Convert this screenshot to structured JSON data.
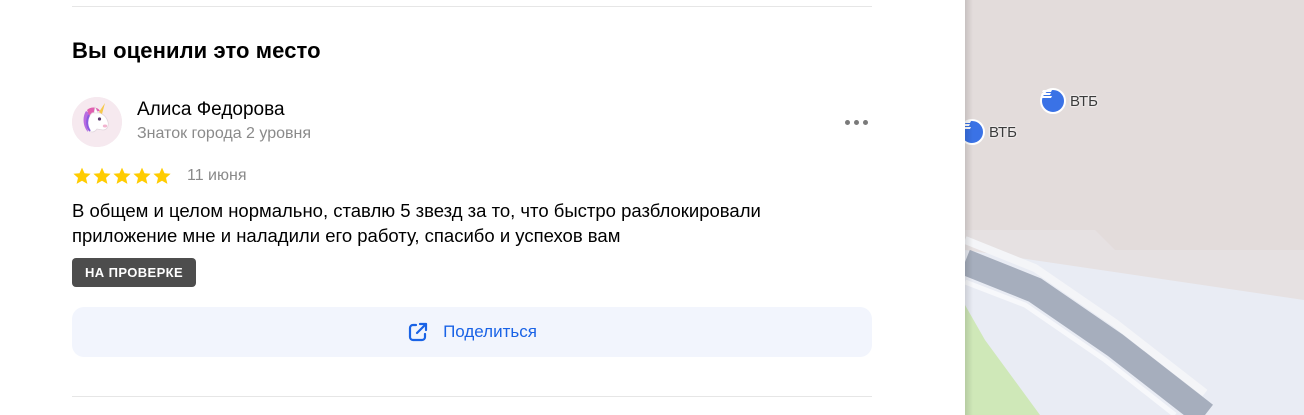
{
  "section": {
    "title": "Вы оценили это место"
  },
  "review": {
    "author": {
      "name": "Алиса Федорова",
      "level": "Знаток города 2 уровня",
      "avatar_icon": "unicorn-avatar-icon"
    },
    "rating": 5,
    "rating_max": 5,
    "star_color": "#fc0",
    "date": "11 июня",
    "text": "В общем и целом нормально, ставлю 5 звезд за то, что быстро разблокировали приложение мне и наладили его работу, спасибо и успехов вам",
    "status": "НА ПРОВЕРКЕ",
    "more_icon": "more-dots-icon"
  },
  "actions": {
    "share_label": "Поделиться",
    "share_icon": "share-external-icon",
    "accent_color": "#1a63e6"
  },
  "map": {
    "pois": [
      {
        "label": "ВТБ",
        "icon": "bank-icon"
      },
      {
        "label": "ВТБ",
        "icon": "bank-icon"
      }
    ]
  }
}
